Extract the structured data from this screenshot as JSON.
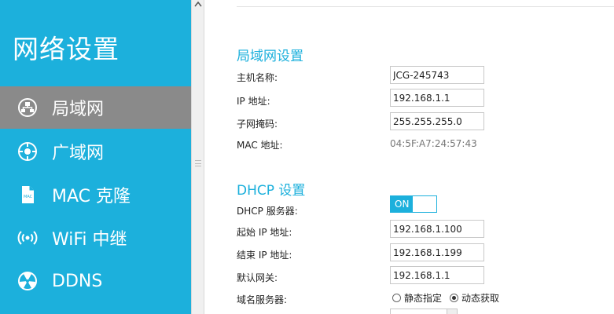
{
  "sidebar": {
    "title": "网络设置",
    "items": [
      {
        "label": "局域网",
        "icon": "lan-icon",
        "active": true
      },
      {
        "label": "广域网",
        "icon": "wan-globe-icon",
        "active": false
      },
      {
        "label": "MAC 克隆",
        "icon": "mac-file-icon",
        "active": false
      },
      {
        "label": "WiFi 中继",
        "icon": "wifi-signal-icon",
        "active": false
      },
      {
        "label": "DDNS",
        "icon": "ddns-icon",
        "active": false
      }
    ]
  },
  "lan": {
    "title": "局域网设置",
    "hostname_label": "主机名称:",
    "hostname_value": "JCG-245743",
    "ip_label": "IP 地址:",
    "ip_value": "192.168.1.1",
    "mask_label": "子网掩码:",
    "mask_value": "255.255.255.0",
    "mac_label": "MAC 地址:",
    "mac_value": "04:5F:A7:24:57:43"
  },
  "dhcp": {
    "title": "DHCP 设置",
    "server_label": "DHCP 服务器:",
    "server_toggle": "ON",
    "start_label": "起始 IP 地址:",
    "start_value": "192.168.1.100",
    "end_label": "结束 IP 地址:",
    "end_value": "192.168.1.199",
    "gateway_label": "默认网关:",
    "gateway_value": "192.168.1.1",
    "dns_label": "域名服务器:",
    "dns_options": {
      "static": "静态指定",
      "dynamic": "动态获取"
    },
    "dns_selected": "dynamic"
  },
  "colors": {
    "accent": "#1cb0dc",
    "sidebar_active": "#8a8a8a"
  }
}
